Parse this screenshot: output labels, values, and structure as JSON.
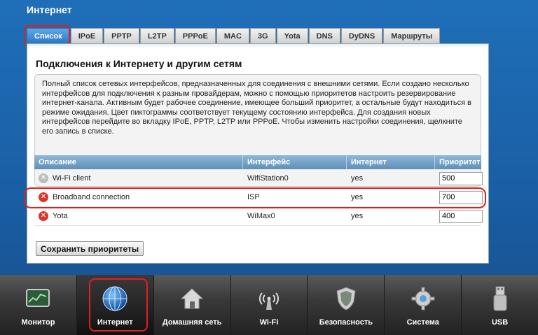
{
  "page": {
    "title": "Интернет"
  },
  "tabs": [
    {
      "label": "Список",
      "active": true
    },
    {
      "label": "IPoE"
    },
    {
      "label": "PPTP"
    },
    {
      "label": "L2TP"
    },
    {
      "label": "PPPoE"
    },
    {
      "label": "MAC"
    },
    {
      "label": "3G"
    },
    {
      "label": "Yota"
    },
    {
      "label": "DNS"
    },
    {
      "label": "DyDNS"
    },
    {
      "label": "Маршруты"
    }
  ],
  "section": {
    "title": "Подключения к Интернету и другим сетям",
    "description": "Полный список сетевых интерфейсов, предназначенных для соединения с внешними сетями. Если создано несколько интерфейсов для подключения к разным провайдерам, можно с помощью приоритетов настроить резервирование интернет-канала. Активным будет рабочее соединение, имеющее больший приоритет, а остальные будут находиться в режиме ожидания. Цвет пиктограммы соответствует текущему состоянию интерфейса. Для создания новых интерфейсов перейдите во вкладку IPoE, PPTP, L2TP или PPPoE. Чтобы изменить настройки соединения, щелкните его запись в списке."
  },
  "table": {
    "headers": {
      "description": "Описание",
      "interface": "Интерфейс",
      "internet": "Интернет",
      "priority": "Приоритет"
    },
    "rows": [
      {
        "status": "gray",
        "name": "Wi-Fi client",
        "interface": "WifiStation0",
        "internet": "yes",
        "priority": "500"
      },
      {
        "status": "red",
        "name": "Broadband connection",
        "interface": "ISP",
        "internet": "yes",
        "priority": "700"
      },
      {
        "status": "red",
        "name": "Yota",
        "interface": "WiMax0",
        "internet": "yes",
        "priority": "400"
      }
    ]
  },
  "actions": {
    "save_label": "Сохранить приоритеты"
  },
  "nav": [
    {
      "label": "Монитор",
      "icon": "monitor-icon"
    },
    {
      "label": "Интернет",
      "icon": "globe-icon",
      "active": true
    },
    {
      "label": "Домашняя сеть",
      "icon": "home-icon"
    },
    {
      "label": "Wi-Fi",
      "icon": "wifi-icon"
    },
    {
      "label": "Безопасность",
      "icon": "shield-icon"
    },
    {
      "label": "Система",
      "icon": "gear-icon"
    },
    {
      "label": "USB",
      "icon": "usb-icon"
    }
  ],
  "colors": {
    "background": "#1a5fa6",
    "tab_active": "#2a77c6",
    "highlight": "#e02020",
    "status_inactive": "#bcbcbc",
    "status_error": "#d9362b"
  }
}
